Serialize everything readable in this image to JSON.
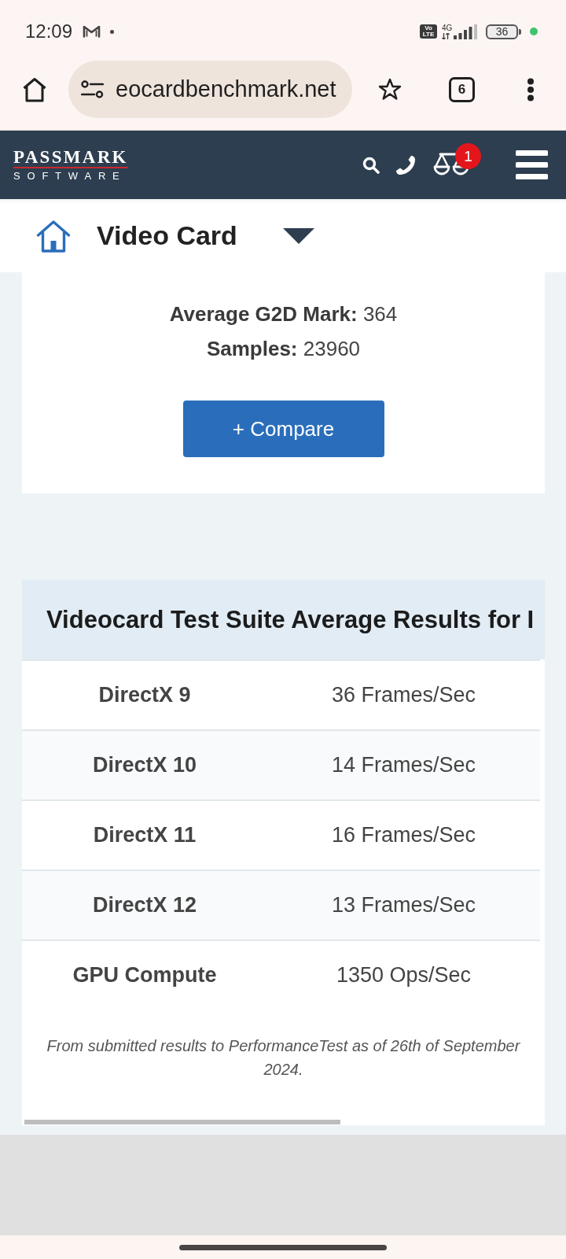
{
  "status_bar": {
    "time": "12:09",
    "volte_badge": [
      "Vo",
      "LTE"
    ],
    "network_type": "4G",
    "battery": "36"
  },
  "browser_toolbar": {
    "url": "eocardbenchmark.net",
    "tab_count": "6"
  },
  "site_header": {
    "logo_name": "PASSMARK",
    "logo_tagline": "SOFTWARE",
    "compare_count": "1"
  },
  "page_nav": {
    "title": "Video Card"
  },
  "summary": {
    "lines": [
      "**Average G2D Mark:** 364",
      "**Samples:** 23960"
    ],
    "compare_button": "+ Compare"
  },
  "results_table": {
    "title": "Videocard Test Suite Average Results for I",
    "rows": [
      {
        "test": "DirectX 9",
        "result": "36 Frames/Sec"
      },
      {
        "test": "DirectX 10",
        "result": "14 Frames/Sec"
      },
      {
        "test": "DirectX 11",
        "result": "16 Frames/Sec"
      },
      {
        "test": "DirectX 12",
        "result": "13 Frames/Sec"
      },
      {
        "test": "GPU Compute",
        "result": "1350 Ops/Sec"
      }
    ],
    "footnote": "From submitted results to PerformanceTest as of 26th of September 2024."
  }
}
